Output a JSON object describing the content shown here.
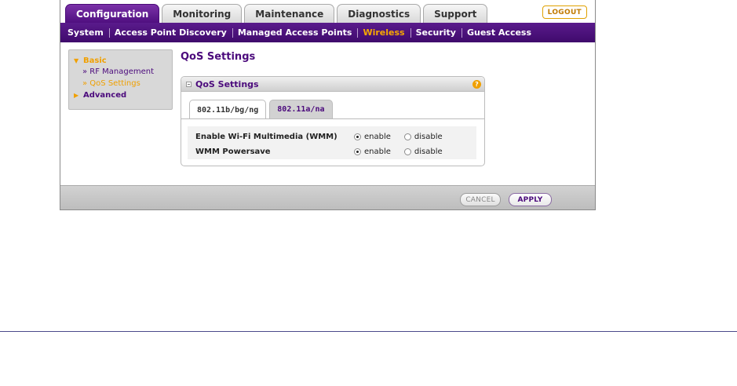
{
  "top_tabs": [
    {
      "label": "Configuration",
      "active": true
    },
    {
      "label": "Monitoring",
      "active": false
    },
    {
      "label": "Maintenance",
      "active": false
    },
    {
      "label": "Diagnostics",
      "active": false
    },
    {
      "label": "Support",
      "active": false
    }
  ],
  "logout_label": "LOGOUT",
  "subnav": [
    {
      "label": "System",
      "active": false
    },
    {
      "label": "Access Point Discovery",
      "active": false
    },
    {
      "label": "Managed Access Points",
      "active": false
    },
    {
      "label": "Wireless",
      "active": true
    },
    {
      "label": "Security",
      "active": false
    },
    {
      "label": "Guest Access",
      "active": false
    }
  ],
  "side_menu": {
    "basic_label": "Basic",
    "basic_items": [
      {
        "label": "» RF Management",
        "active": false
      },
      {
        "label": "» QoS Settings",
        "active": true
      }
    ],
    "advanced_label": "Advanced"
  },
  "page_title": "QoS Settings",
  "panel": {
    "title": "QoS Settings",
    "help_glyph": "?",
    "tabs": [
      {
        "label": "802.11b/bg/ng",
        "active": true
      },
      {
        "label": "802.11a/na",
        "active": false
      }
    ],
    "settings": [
      {
        "label": "Enable Wi-Fi Multimedia (WMM)",
        "options": [
          "enable",
          "disable"
        ],
        "selected": "enable"
      },
      {
        "label": "WMM Powersave",
        "options": [
          "enable",
          "disable"
        ],
        "selected": "enable"
      }
    ]
  },
  "footer": {
    "cancel_label": "CANCEL",
    "apply_label": "APPLY"
  },
  "colors": {
    "brand_purple": "#4b0a7c",
    "accent_orange": "#f0a000"
  }
}
